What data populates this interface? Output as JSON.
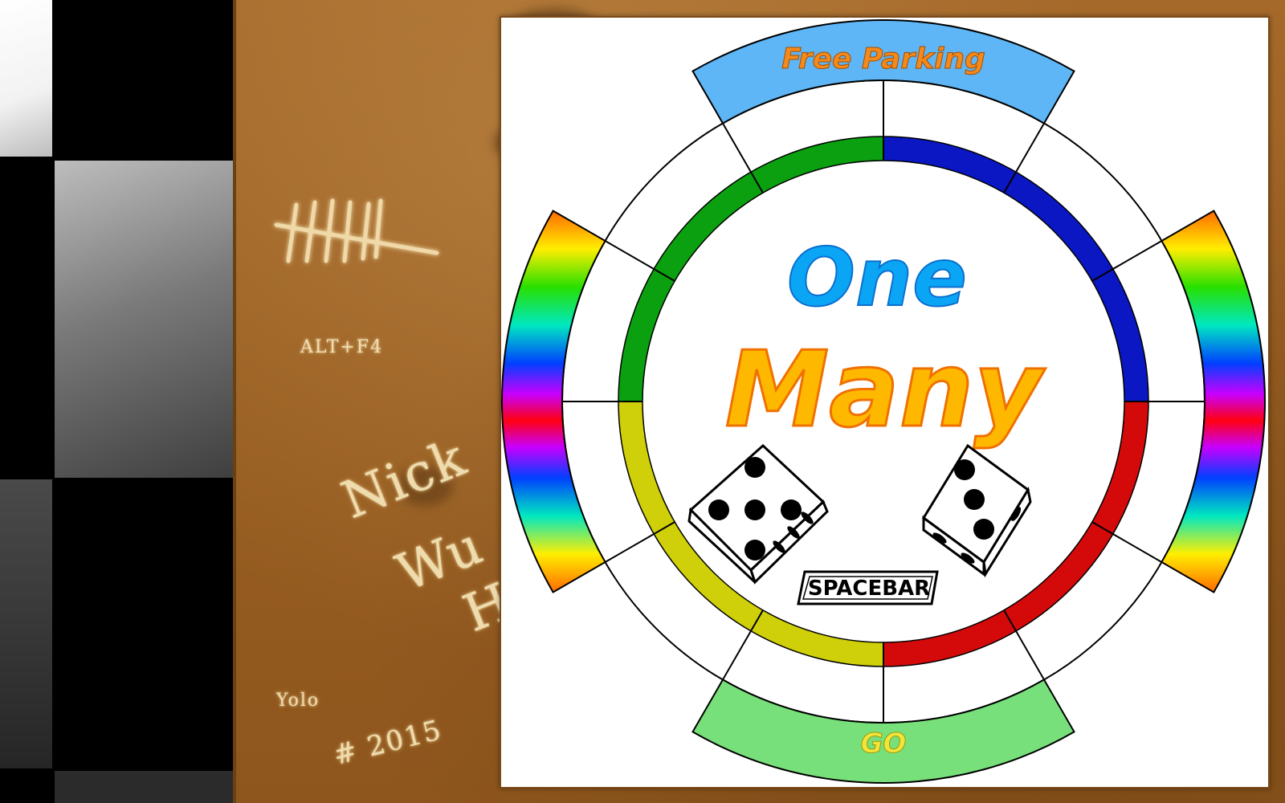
{
  "board": {
    "top_label": "Free Parking",
    "bottom_label": "GO",
    "title_line1": "One",
    "title_line2": "Many",
    "spacebar_key": "SPACEBAR"
  },
  "dice": [
    {
      "name": "left-die",
      "face": 5
    },
    {
      "name": "right-die",
      "face": 3
    }
  ],
  "table_carvings": {
    "shortcut": "ALT+F4",
    "name_line1": "Nick",
    "name_line2": "Wu",
    "name_line3": "H",
    "yolo": "Yolo",
    "year": "# 2015"
  },
  "colors": {
    "free_parking_bg": "#5eb6f6",
    "free_parking_text": "#f58a1c",
    "go_bg": "#78e07a",
    "go_text": "#f2e53a",
    "green_ring": "#0aa00f",
    "blue_ring": "#0a17c2",
    "red_ring": "#d40a0a",
    "yellow_ring": "#cfcf0a",
    "title_one": "#0aa6f5",
    "title_many": "#ffb800"
  }
}
